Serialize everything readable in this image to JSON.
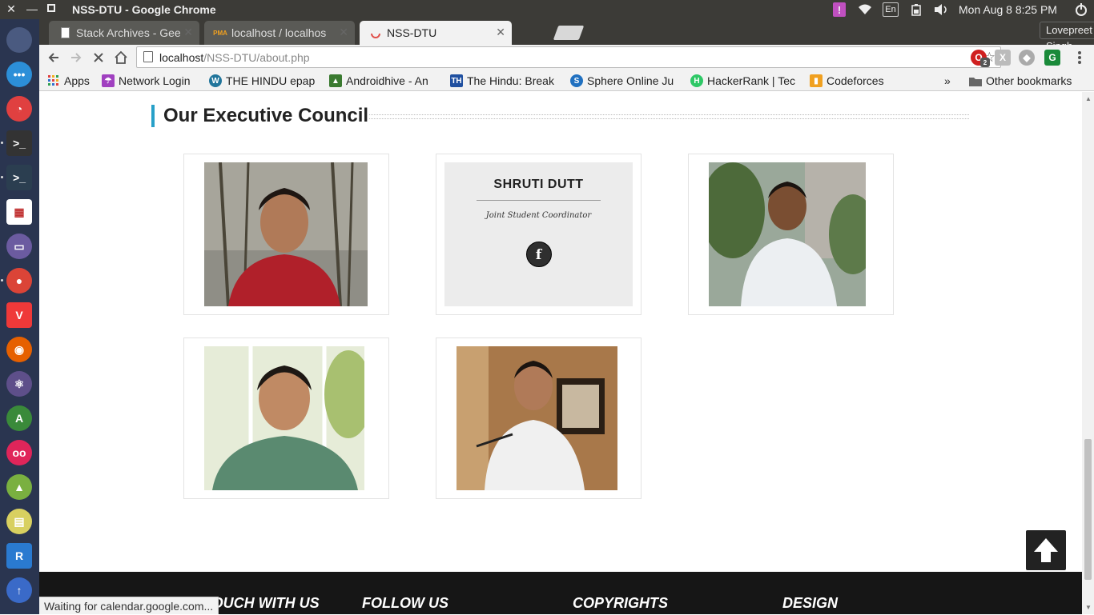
{
  "window": {
    "title": "NSS-DTU - Google Chrome"
  },
  "system": {
    "keyboard_layout": "En",
    "clock": "Mon Aug  8  8:25 PM",
    "user": "Lovepreet Singh"
  },
  "launcher": {
    "items": [
      {
        "icon": "apple-icon",
        "color": "#4a5a80"
      },
      {
        "icon": "chat-icon",
        "color": "#2c8fd8"
      },
      {
        "icon": "disk-usage-icon",
        "color": "#e04040"
      },
      {
        "icon": "terminal-icon",
        "color": "#333333"
      },
      {
        "icon": "terminal-alt-icon",
        "color": "#2b3e50"
      },
      {
        "icon": "app-grid-icon",
        "color": "#ffffff"
      },
      {
        "icon": "files-icon",
        "color": "#6b5ba0"
      },
      {
        "icon": "chrome-icon",
        "color": "#db4437"
      },
      {
        "icon": "vivaldi-icon",
        "color": "#ef3939"
      },
      {
        "icon": "firefox-icon",
        "color": "#e66000"
      },
      {
        "icon": "atom-icon",
        "color": "#5e4f8a"
      },
      {
        "icon": "android-studio-icon",
        "color": "#3a8a3a"
      },
      {
        "icon": "flickr-icon",
        "color": "#e0255a"
      },
      {
        "icon": "android-icon",
        "color": "#7ab040"
      },
      {
        "icon": "archive-icon",
        "color": "#d8d060"
      },
      {
        "icon": "r-icon",
        "color": "#2a7ad0"
      },
      {
        "icon": "updater-icon",
        "color": "#3a6ac8"
      }
    ]
  },
  "tabs": [
    {
      "title": "Stack Archives - Gee",
      "favicon": "page-icon",
      "active": false
    },
    {
      "title": "localhost / localhos",
      "favicon": "phpmyadmin-icon",
      "active": false
    },
    {
      "title": "NSS-DTU",
      "favicon": "loading-icon",
      "active": true
    }
  ],
  "toolbar": {
    "url_host": "localhost",
    "url_path": "/NSS-DTU/about.php",
    "ext_badge": "2"
  },
  "bookmarks": {
    "apps": "Apps",
    "items": [
      {
        "label": "Network Login",
        "icon": "umbrella-icon",
        "color": "#a040c0"
      },
      {
        "label": "THE HINDU epap",
        "icon": "wordpress-icon",
        "color": "#21759b"
      },
      {
        "label": "Androidhive - An",
        "icon": "android-hive-icon",
        "color": "#3a7a30"
      },
      {
        "label": "The Hindu: Break",
        "icon": "th-icon",
        "color": "#2050a0"
      },
      {
        "label": "Sphere Online Ju",
        "icon": "spoj-icon",
        "color": "#2070c0"
      },
      {
        "label": "HackerRank | Tec",
        "icon": "hackerrank-icon",
        "color": "#2ec866"
      },
      {
        "label": "Codeforces",
        "icon": "codeforces-icon",
        "color": "#f0a020"
      }
    ],
    "overflow": "»",
    "other": "Other bookmarks"
  },
  "page": {
    "section_title": "Our Executive Council",
    "members": [
      {
        "kind": "photo"
      },
      {
        "kind": "overlay",
        "name": "SHRUTI DUTT",
        "role": "Joint Student Coordinator",
        "social": "f"
      },
      {
        "kind": "photo"
      },
      {
        "kind": "photo"
      },
      {
        "kind": "photo"
      }
    ],
    "footer": {
      "headings": [
        "GET IN TOUCH WITH US",
        "FOLLOW US",
        "COPYRIGHTS",
        "DESIGN"
      ]
    }
  },
  "status_bar": {
    "text": "Waiting for calendar.google.com..."
  }
}
